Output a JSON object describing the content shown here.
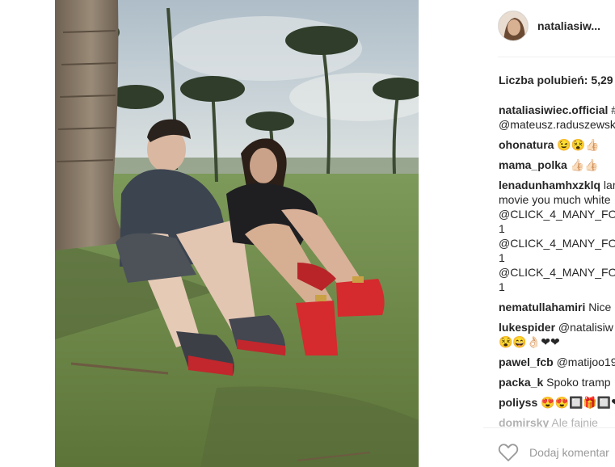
{
  "post": {
    "username": "nataliasiw...",
    "likes_label": "Liczba polubień: 5,29"
  },
  "comments": [
    {
      "user": "nataliasiwiec.official",
      "text": " #",
      "lines": [
        "@mateusz.raduszewsk"
      ]
    },
    {
      "user": "ohonatura",
      "text": " 😉😵👍🏻"
    },
    {
      "user": "mama_polka",
      "text": " 👍🏻👍🏻"
    },
    {
      "user": "lenadunhamhxzklq",
      "text": " lar",
      "lines": [
        "movie you much white",
        "@CLICK_4_MANY_FO",
        "1",
        "@CLICK_4_MANY_FO",
        "1",
        "@CLICK_4_MANY_FO",
        "1"
      ]
    },
    {
      "user": "nematullahamiri",
      "text": " Nice"
    },
    {
      "user": "lukespider",
      "text": " @natalisiw",
      "lines": [
        "😵😄👌🏻❤❤"
      ]
    },
    {
      "user": "pawel_fcb",
      "text": " @matijoo19"
    },
    {
      "user": "packa_k",
      "text": " Spoko tramp"
    },
    {
      "user": "poliyss",
      "text": " 😍😍🔲🎁🔲❤"
    },
    {
      "user": "domirsky",
      "text": " Ale fajnie"
    }
  ],
  "composer": {
    "placeholder": "Dodaj komentar"
  },
  "colors": {
    "link": "#003569",
    "text": "#262626",
    "muted": "#999999"
  },
  "icons": {
    "like": "heart-outline-icon"
  }
}
